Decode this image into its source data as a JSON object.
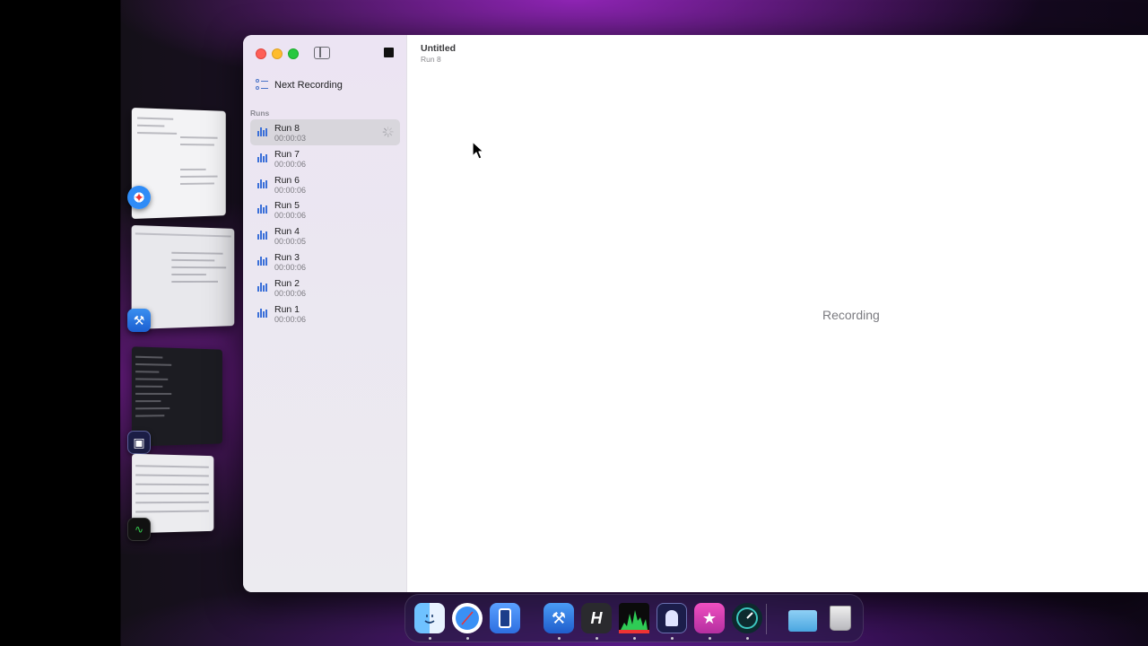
{
  "window": {
    "title": "Untitled",
    "subtitle": "Run 8"
  },
  "sidebar": {
    "next_recording_label": "Next Recording",
    "section_header": "Runs",
    "runs": [
      {
        "name": "Run 8",
        "duration": "00:00:03",
        "selected": true,
        "in_progress": true
      },
      {
        "name": "Run 7",
        "duration": "00:00:06"
      },
      {
        "name": "Run 6",
        "duration": "00:00:06"
      },
      {
        "name": "Run 5",
        "duration": "00:00:06"
      },
      {
        "name": "Run 4",
        "duration": "00:00:05"
      },
      {
        "name": "Run 3",
        "duration": "00:00:06"
      },
      {
        "name": "Run 2",
        "duration": "00:00:06"
      },
      {
        "name": "Run 1",
        "duration": "00:00:06"
      }
    ]
  },
  "content": {
    "status": "Recording"
  },
  "stage_manager": [
    {
      "app_icon": "safari-icon"
    },
    {
      "app_icon": "xcode-beta-icon"
    },
    {
      "app_icon": "terminal-app-icon"
    },
    {
      "app_icon": "activity-monitor-icon"
    }
  ],
  "dock": [
    {
      "icon": "finder-icon",
      "running": true
    },
    {
      "icon": "safari-icon",
      "running": true
    },
    {
      "icon": "simulator-icon",
      "running": false
    },
    {
      "icon": "xcode-beta-icon",
      "running": true
    },
    {
      "icon": "hopper-icon",
      "running": true
    },
    {
      "icon": "activity-monitor-icon",
      "running": true
    },
    {
      "icon": "terminal-app-icon",
      "running": true
    },
    {
      "icon": "instruments-icon",
      "running": true
    },
    {
      "icon": "speedometer-beta-icon",
      "running": true
    },
    {
      "icon": "downloads-folder-icon",
      "running": false
    },
    {
      "icon": "trash-icon",
      "running": false
    }
  ]
}
